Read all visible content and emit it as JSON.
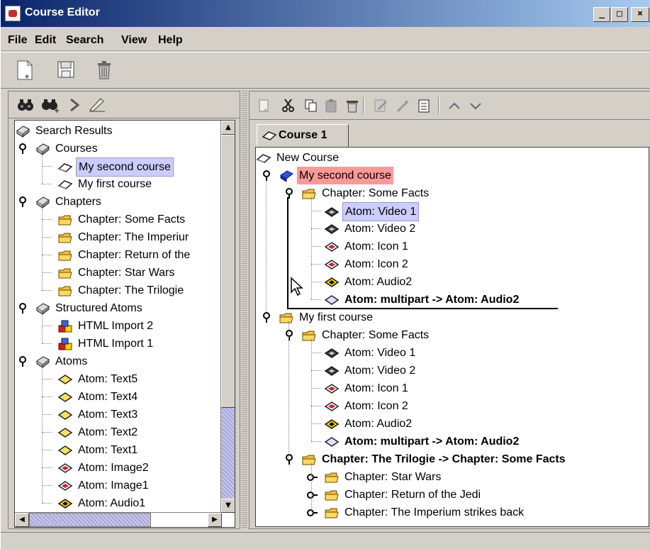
{
  "window": {
    "title": "Course Editor",
    "minimize": "_",
    "maximize": "□",
    "close": "×"
  },
  "menu": [
    "File",
    "Edit",
    "Search",
    "View",
    "Help"
  ],
  "toolbar": {
    "icons": [
      "new-document-icon",
      "save-icon",
      "trash-icon"
    ]
  },
  "left_toolbar": {
    "icons": [
      "binoculars-icon",
      "binoculars-plus-icon",
      "forward-icon",
      "filter-icon"
    ]
  },
  "right_toolbar": {
    "icons": [
      "new-icon",
      "cut-icon",
      "copy-icon",
      "paste-icon",
      "delete-icon",
      "edit-icon",
      "wizard-icon",
      "properties-icon",
      "move-up-icon",
      "move-down-icon"
    ]
  },
  "left_tree": {
    "root": "Search Results",
    "groups": [
      {
        "label": "Courses",
        "items": [
          "My second course",
          "My first course"
        ],
        "item_icon": "course"
      },
      {
        "label": "Chapters",
        "items": [
          "Chapter: Some Facts",
          "Chapter: The Imperiur",
          "Chapter: Return of the",
          "Chapter: Star Wars",
          "Chapter: The Trilogie"
        ],
        "item_icon": "folder"
      },
      {
        "label": "Structured Atoms",
        "items": [
          "HTML Import 2",
          "HTML Import 1"
        ],
        "item_icon": "blocks"
      },
      {
        "label": "Atoms",
        "items": [
          "Atom: Text5",
          "Atom: Text4",
          "Atom: Text3",
          "Atom: Text2",
          "Atom: Text1",
          "Atom: Image2",
          "Atom: Image1",
          "Atom: Audio1"
        ],
        "item_icon": "atom"
      }
    ]
  },
  "tab": {
    "label": "Course 1"
  },
  "right_tree": {
    "root": "New Course",
    "course1": {
      "label": "My second course",
      "chapter": "Chapter: Some Facts",
      "atoms": [
        "Atom: Video 1",
        "Atom: Video 2",
        "Atom: Icon 1",
        "Atom: Icon 2",
        "Atom: Audio2"
      ],
      "multipart": "Atom: multipart -> Atom: Audio2"
    },
    "course2": {
      "label": "My first course",
      "chapter": "Chapter: Some Facts",
      "atoms": [
        "Atom: Video 1",
        "Atom: Video 2",
        "Atom: Icon 1",
        "Atom: Icon 2",
        "Atom: Audio2"
      ],
      "multipart": "Atom: multipart -> Atom: Audio2",
      "link_chapter": "Chapter: The Trilogie -> Chapter: Some Facts",
      "sub_chapters": [
        "Chapter: Star Wars",
        "Chapter: Return of the Jedi",
        "Chapter: The Imperium strikes back"
      ]
    }
  },
  "colors": {
    "selection": "#ccccff",
    "highlight": "#ff9999",
    "titlebar": "#0a246a"
  }
}
